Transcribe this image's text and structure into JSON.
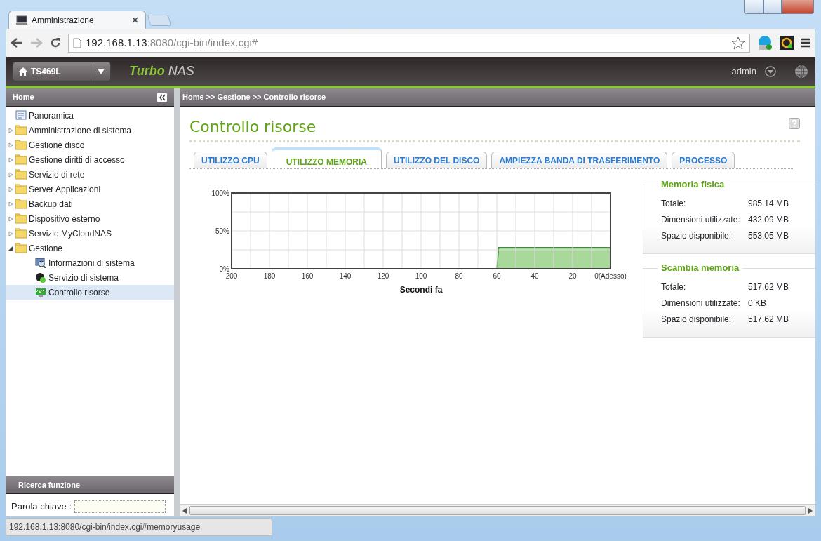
{
  "window": {
    "tab_title": "Amministrazione",
    "url_host": "192.168.1.13",
    "url_rest": ":8080/cgi-bin/index.cgi#"
  },
  "header": {
    "device": "TS469L",
    "brand_bold": "Turbo",
    "brand_rest": "NAS",
    "user": "admin"
  },
  "sidebar": {
    "title": "Home",
    "items": [
      {
        "label": "Panoramica",
        "kind": "page",
        "selected": false
      },
      {
        "label": "Amministrazione di sistema",
        "kind": "folder",
        "expanded": false,
        "selected": false
      },
      {
        "label": "Gestione disco",
        "kind": "folder",
        "expanded": false,
        "selected": false
      },
      {
        "label": "Gestione diritti di accesso",
        "kind": "folder",
        "expanded": false,
        "selected": false
      },
      {
        "label": "Servizio di rete",
        "kind": "folder",
        "expanded": false,
        "selected": false
      },
      {
        "label": "Server Applicazioni",
        "kind": "folder",
        "expanded": false,
        "selected": false
      },
      {
        "label": "Backup dati",
        "kind": "folder",
        "expanded": false,
        "selected": false
      },
      {
        "label": "Dispositivo esterno",
        "kind": "folder",
        "expanded": false,
        "selected": false
      },
      {
        "label": "Servizio MyCloudNAS",
        "kind": "folder",
        "expanded": false,
        "selected": false
      },
      {
        "label": "Gestione",
        "kind": "folder",
        "expanded": true,
        "selected": false,
        "children": [
          {
            "label": "Informazioni di sistema",
            "kind": "info",
            "selected": false
          },
          {
            "label": "Servizio di sistema",
            "kind": "service",
            "selected": false
          },
          {
            "label": "Controllo risorse",
            "kind": "monitor",
            "selected": true
          }
        ]
      }
    ]
  },
  "breadcrumb": "Home >> Gestione >> Controllo risorse",
  "page_title": "Controllo risorse",
  "tabs": [
    {
      "label": "UTILIZZO CPU",
      "selected": false
    },
    {
      "label": "UTILIZZO MEMORIA",
      "selected": true
    },
    {
      "label": "UTILIZZO DEL DISCO",
      "selected": false
    },
    {
      "label": "AMPIEZZA BANDA DI TRASFERIMENTO",
      "selected": false
    },
    {
      "label": "PROCESSO",
      "selected": false
    }
  ],
  "chart": {
    "chart_data": {
      "type": "area",
      "grid": true,
      "xlabel": "Secondi fa",
      "x": [
        200,
        60,
        59,
        0
      ],
      "xlim": [
        200,
        0
      ],
      "ylim": [
        0,
        100
      ],
      "series": [
        {
          "color": "#a8d89a",
          "values": [
            0,
            0,
            28,
            28
          ]
        }
      ],
      "xticks": [
        200,
        180,
        160,
        140,
        120,
        100,
        80,
        60,
        40,
        20,
        {
          "value": 0,
          "label": "0(Adesso)"
        }
      ],
      "yticks": [
        {
          "value": 0,
          "label": "0%"
        },
        {
          "value": 50,
          "label": "50%"
        },
        {
          "value": 100,
          "label": "100%"
        }
      ]
    }
  },
  "panels": [
    {
      "title": "Memoria fisica",
      "rows": [
        {
          "label": "Totale:",
          "value": "985.14 MB"
        },
        {
          "label": "Dimensioni utilizzate:",
          "value": "432.09 MB"
        },
        {
          "label": "Spazio disponibile:",
          "value": "553.05 MB"
        }
      ]
    },
    {
      "title": "Scambia memoria",
      "rows": [
        {
          "label": "Totale:",
          "value": "517.62 MB"
        },
        {
          "label": "Dimensioni utilizzate:",
          "value": "0 KB"
        },
        {
          "label": "Spazio disponibile:",
          "value": "517.62 MB"
        }
      ]
    }
  ],
  "search": {
    "title": "Ricerca funzione",
    "label": "Parola chiave :"
  },
  "status_bar": "192.168.1.13:8080/cgi-bin/index.cgi#memoryusage"
}
